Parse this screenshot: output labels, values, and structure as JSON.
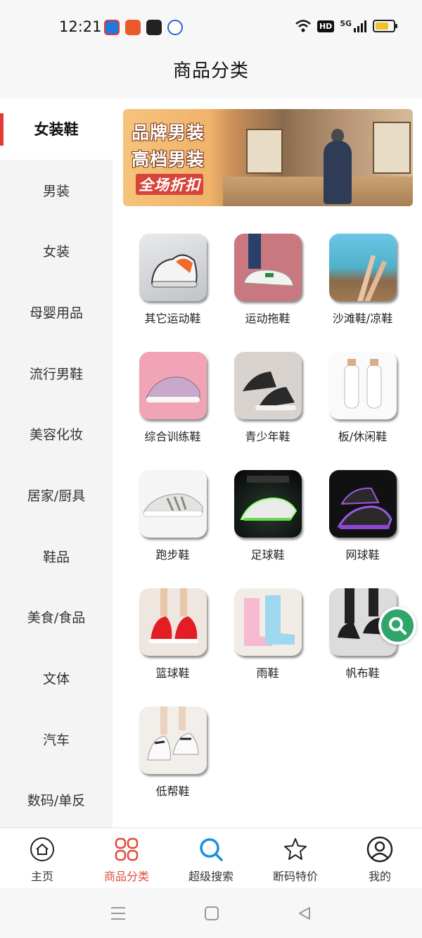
{
  "status_bar": {
    "time": "12:21",
    "hd_label": "HD",
    "network_label": "5G"
  },
  "header": {
    "title": "商品分类"
  },
  "sidebar": {
    "items": [
      {
        "label": "女装鞋",
        "active": true
      },
      {
        "label": "男装"
      },
      {
        "label": "女装"
      },
      {
        "label": "母婴用品"
      },
      {
        "label": "流行男鞋"
      },
      {
        "label": "美容化妆"
      },
      {
        "label": "居家/厨具"
      },
      {
        "label": "鞋品"
      },
      {
        "label": "美食/食品"
      },
      {
        "label": "文体"
      },
      {
        "label": "汽车"
      },
      {
        "label": "数码/单反"
      }
    ]
  },
  "banner": {
    "line1": "品牌男装",
    "line2": "高档男装",
    "line3": "全场折扣"
  },
  "categories": [
    {
      "label": "其它运动鞋"
    },
    {
      "label": "运动拖鞋"
    },
    {
      "label": "沙滩鞋/凉鞋"
    },
    {
      "label": "综合训练鞋"
    },
    {
      "label": "青少年鞋"
    },
    {
      "label": "板/休闲鞋"
    },
    {
      "label": "跑步鞋"
    },
    {
      "label": "足球鞋"
    },
    {
      "label": "网球鞋"
    },
    {
      "label": "篮球鞋"
    },
    {
      "label": "雨鞋"
    },
    {
      "label": "帆布鞋"
    },
    {
      "label": "低帮鞋"
    }
  ],
  "bottom_nav": {
    "items": [
      {
        "label": "主页",
        "icon": "home-icon"
      },
      {
        "label": "商品分类",
        "icon": "category-grid-icon",
        "active": true
      },
      {
        "label": "超级搜索",
        "icon": "search-icon"
      },
      {
        "label": "断码特价",
        "icon": "star-icon"
      },
      {
        "label": "我的",
        "icon": "user-icon"
      }
    ]
  },
  "colors": {
    "accent_red": "#e53935",
    "nav_active": "#e04b3a",
    "search_blue": "#1a8fe0",
    "float_green": "#2fa56a"
  }
}
